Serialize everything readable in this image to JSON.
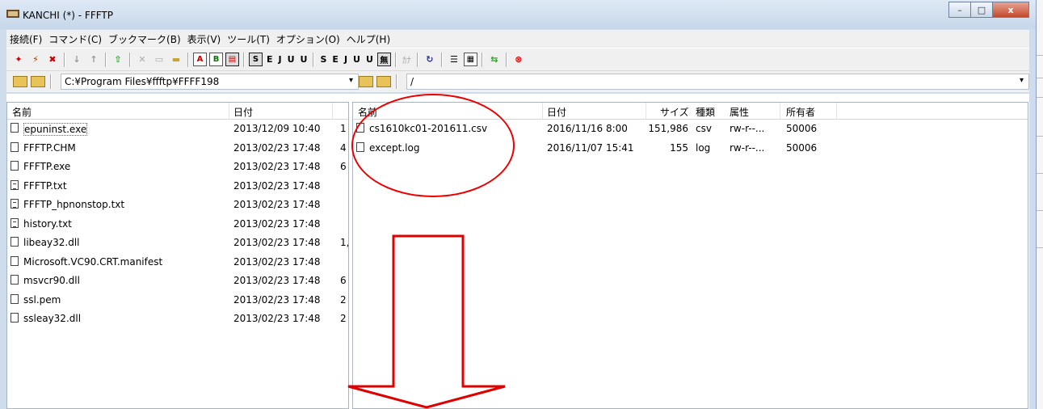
{
  "window": {
    "title": "KANCHI (*) - FFFTP"
  },
  "window_buttons": {
    "minimize": "–",
    "maximize": "□",
    "close": "x"
  },
  "menu": [
    "接続(F)",
    "コマンド(C)",
    "ブックマーク(B)",
    "表示(V)",
    "ツール(T)",
    "オプション(O)",
    "ヘルプ(H)"
  ],
  "toolbar": {
    "letter_buttons": [
      "A",
      "B",
      "S",
      "E",
      "J",
      "U",
      "U",
      "S",
      "E",
      "J",
      "U",
      "U",
      "無",
      "ｶﾅ"
    ]
  },
  "local": {
    "path": "C:¥Program Files¥ffftp¥FFFF198",
    "columns": {
      "name": "名前",
      "date": "日付"
    },
    "files": [
      {
        "name": "epuninst.exe",
        "date": "2013/12/09 10:40",
        "size": "1",
        "icon": "file",
        "focused": true
      },
      {
        "name": "FFFTP.CHM",
        "date": "2013/02/23 17:48",
        "size": "4",
        "icon": "file"
      },
      {
        "name": "FFFTP.exe",
        "date": "2013/02/23 17:48",
        "size": "6",
        "icon": "file"
      },
      {
        "name": "FFFTP.txt",
        "date": "2013/02/23 17:48",
        "size": "",
        "icon": "text"
      },
      {
        "name": "FFFTP_hpnonstop.txt",
        "date": "2013/02/23 17:48",
        "size": "",
        "icon": "text"
      },
      {
        "name": "history.txt",
        "date": "2013/02/23 17:48",
        "size": "",
        "icon": "text"
      },
      {
        "name": "libeay32.dll",
        "date": "2013/02/23 17:48",
        "size": "1,",
        "icon": "file"
      },
      {
        "name": "Microsoft.VC90.CRT.manifest",
        "date": "2013/02/23 17:48",
        "size": "",
        "icon": "file"
      },
      {
        "name": "msvcr90.dll",
        "date": "2013/02/23 17:48",
        "size": "6",
        "icon": "file"
      },
      {
        "name": "ssl.pem",
        "date": "2013/02/23 17:48",
        "size": "2",
        "icon": "file"
      },
      {
        "name": "ssleay32.dll",
        "date": "2013/02/23 17:48",
        "size": "2",
        "icon": "file"
      }
    ]
  },
  "remote": {
    "path": "/",
    "columns": {
      "name": "名前",
      "date": "日付",
      "size": "サイズ",
      "type": "種類",
      "attr": "属性",
      "owner": "所有者"
    },
    "files": [
      {
        "name": "cs1610kc01-201611.csv",
        "date": "2016/11/16  8:00",
        "size": "151,986",
        "type": "csv",
        "attr": "rw-r--...",
        "owner": "50006"
      },
      {
        "name": "except.log",
        "date": "2016/11/07 15:41",
        "size": "155",
        "type": "log",
        "attr": "rw-r--...",
        "owner": "50006"
      }
    ]
  },
  "colors": {
    "annotation": "#e00000",
    "window_frame": "#cfdcec"
  }
}
